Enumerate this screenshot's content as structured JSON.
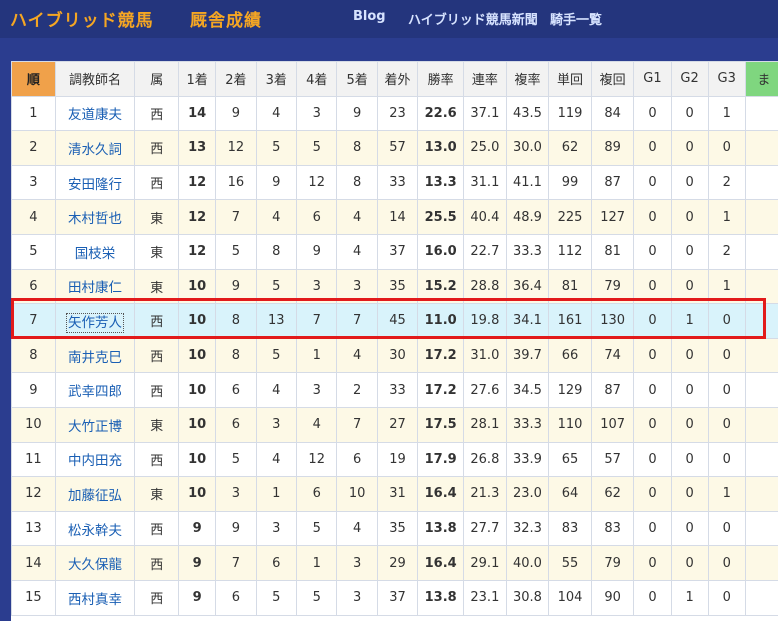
{
  "header": {
    "site_title": "ハイブリッド競馬",
    "page_title": "厩舎成績",
    "nav": [
      "Blog",
      "ハイブリッド競馬新聞",
      "騎手一覧"
    ]
  },
  "table": {
    "columns": [
      "順",
      "調教師名",
      "属",
      "1着",
      "2着",
      "3着",
      "4着",
      "5着",
      "着外",
      "勝率",
      "連率",
      "複率",
      "単回",
      "複回",
      "G1",
      "G2",
      "G3",
      "ま"
    ],
    "rows": [
      [
        "1",
        "友道康夫",
        "西",
        "14",
        "9",
        "4",
        "3",
        "9",
        "23",
        "22.6",
        "37.1",
        "43.5",
        "119",
        "84",
        "0",
        "0",
        "1",
        ""
      ],
      [
        "2",
        "清水久詞",
        "西",
        "13",
        "12",
        "5",
        "5",
        "8",
        "57",
        "13.0",
        "25.0",
        "30.0",
        "62",
        "89",
        "0",
        "0",
        "0",
        ""
      ],
      [
        "3",
        "安田隆行",
        "西",
        "12",
        "16",
        "9",
        "12",
        "8",
        "33",
        "13.3",
        "31.1",
        "41.1",
        "99",
        "87",
        "0",
        "0",
        "2",
        ""
      ],
      [
        "4",
        "木村哲也",
        "東",
        "12",
        "7",
        "4",
        "6",
        "4",
        "14",
        "25.5",
        "40.4",
        "48.9",
        "225",
        "127",
        "0",
        "0",
        "1",
        ""
      ],
      [
        "5",
        "国枝栄",
        "東",
        "12",
        "5",
        "8",
        "9",
        "4",
        "37",
        "16.0",
        "22.7",
        "33.3",
        "112",
        "81",
        "0",
        "0",
        "2",
        ""
      ],
      [
        "6",
        "田村康仁",
        "東",
        "10",
        "9",
        "5",
        "3",
        "3",
        "35",
        "15.2",
        "28.8",
        "36.4",
        "81",
        "79",
        "0",
        "0",
        "1",
        ""
      ],
      [
        "7",
        "矢作芳人",
        "西",
        "10",
        "8",
        "13",
        "7",
        "7",
        "45",
        "11.0",
        "19.8",
        "34.1",
        "161",
        "130",
        "0",
        "1",
        "0",
        ""
      ],
      [
        "8",
        "南井克巳",
        "西",
        "10",
        "8",
        "5",
        "1",
        "4",
        "30",
        "17.2",
        "31.0",
        "39.7",
        "66",
        "74",
        "0",
        "0",
        "0",
        ""
      ],
      [
        "9",
        "武幸四郎",
        "西",
        "10",
        "6",
        "4",
        "3",
        "2",
        "33",
        "17.2",
        "27.6",
        "34.5",
        "129",
        "87",
        "0",
        "0",
        "0",
        ""
      ],
      [
        "10",
        "大竹正博",
        "東",
        "10",
        "6",
        "3",
        "4",
        "7",
        "27",
        "17.5",
        "28.1",
        "33.3",
        "110",
        "107",
        "0",
        "0",
        "0",
        ""
      ],
      [
        "11",
        "中内田充",
        "西",
        "10",
        "5",
        "4",
        "12",
        "6",
        "19",
        "17.9",
        "26.8",
        "33.9",
        "65",
        "57",
        "0",
        "0",
        "0",
        ""
      ],
      [
        "12",
        "加藤征弘",
        "東",
        "10",
        "3",
        "1",
        "6",
        "10",
        "31",
        "16.4",
        "21.3",
        "23.0",
        "64",
        "62",
        "0",
        "0",
        "1",
        ""
      ],
      [
        "13",
        "松永幹夫",
        "西",
        "9",
        "9",
        "3",
        "5",
        "4",
        "35",
        "13.8",
        "27.7",
        "32.3",
        "83",
        "83",
        "0",
        "0",
        "0",
        ""
      ],
      [
        "14",
        "大久保龍",
        "西",
        "9",
        "7",
        "6",
        "1",
        "3",
        "29",
        "16.4",
        "29.1",
        "40.0",
        "55",
        "79",
        "0",
        "0",
        "0",
        ""
      ],
      [
        "15",
        "西村真幸",
        "西",
        "9",
        "6",
        "5",
        "5",
        "3",
        "37",
        "13.8",
        "23.1",
        "30.8",
        "104",
        "90",
        "0",
        "1",
        "0",
        ""
      ]
    ],
    "highlighted_row": 6
  },
  "colors": {
    "background": "#2b3d8f",
    "title": "#f5a623",
    "link": "#1a5fb4",
    "rank_header": "#f0a14a",
    "highlight_border": "#e21a1a",
    "highlight_row": "#d9f3fb"
  }
}
